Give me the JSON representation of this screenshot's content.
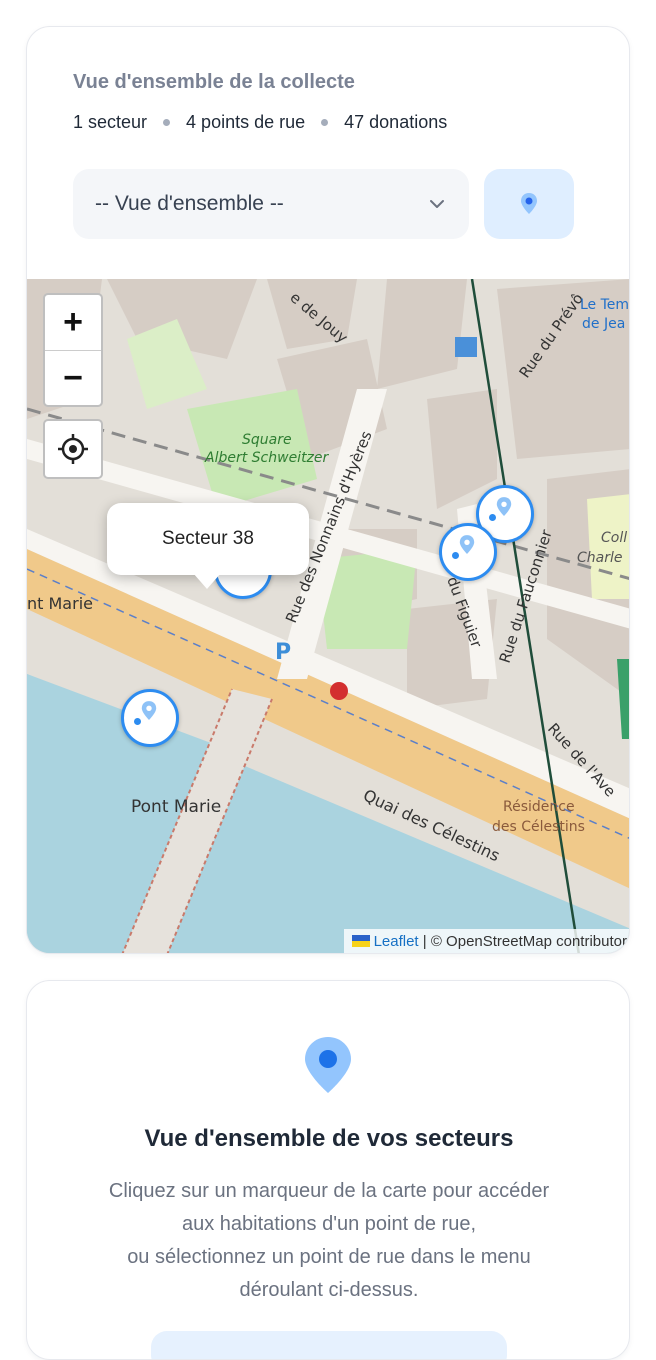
{
  "summary": {
    "title": "Vue d'ensemble de la collecte",
    "stats": [
      "1 secteur",
      "4 points de rue",
      "47 donations"
    ]
  },
  "selector": {
    "value": "-- Vue d'ensemble --",
    "locate_icon": "map-pin-icon"
  },
  "map": {
    "zoom_in": "+",
    "zoom_out": "−",
    "locate_icon": "crosshair-icon",
    "popup": "Secteur 38",
    "attribution": {
      "leaflet": "Leaflet",
      "rest": " | © OpenStreetMap contributor"
    },
    "labels": {
      "quai": "Quai des Célestins",
      "pont": "Pont Marie",
      "pont_street": "nt Marie",
      "nonnains": "Rue des Nonnains d'Hyères",
      "figuier": "du Figuier",
      "fauconnier": "Rue du Fauconnier",
      "ave": "Rue de l'Ave",
      "jouy": "e de Jouy",
      "prevot": "Rue du Prévô",
      "square1": "Square",
      "square2": "Albert Schweitzer",
      "residence1": "Résidence",
      "residence2": "des Célestins",
      "letemp1": "Le Tem",
      "letemp2": "de Jea",
      "coll1": "Coll",
      "coll2": "Charle"
    },
    "colors": {
      "water": "#aad3df",
      "quai": "#f0c98a",
      "park": "#c8e8b4",
      "building": "#d9d0c9",
      "marker": "#2d8cf0"
    }
  },
  "info": {
    "icon": "map-pin-icon",
    "title": "Vue d'ensemble de vos secteurs",
    "lines": [
      "Cliquez sur un marqueur de la carte pour accéder",
      "aux habitations d'un point de rue,",
      "ou sélectionnez un point de rue dans le menu",
      "déroulant ci-dessus."
    ]
  }
}
